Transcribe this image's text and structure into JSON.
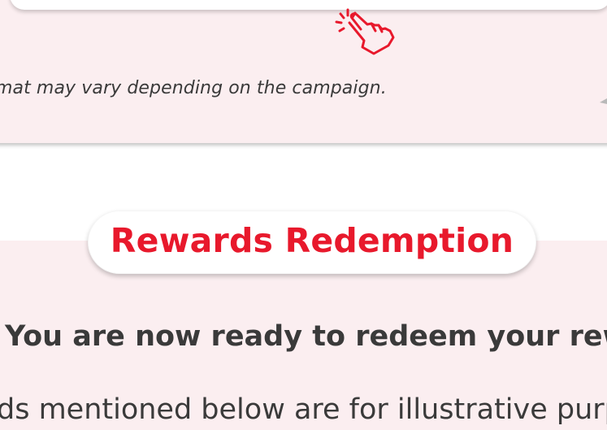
{
  "previous_section": {
    "note": "mat may vary depending on the campaign.",
    "tap_icon": "hand-tap-icon",
    "arrow_icon": "arrow-left-icon"
  },
  "rewards_section": {
    "title": "Rewards Redemption",
    "ready_text": "You are now ready to redeem your rewards",
    "illustrative_text": "ds mentioned below are for illustrative purpos"
  },
  "colors": {
    "accent_red": "#e8192c",
    "panel_pink": "#fbeef0",
    "text_dark": "#3a3a3a"
  }
}
